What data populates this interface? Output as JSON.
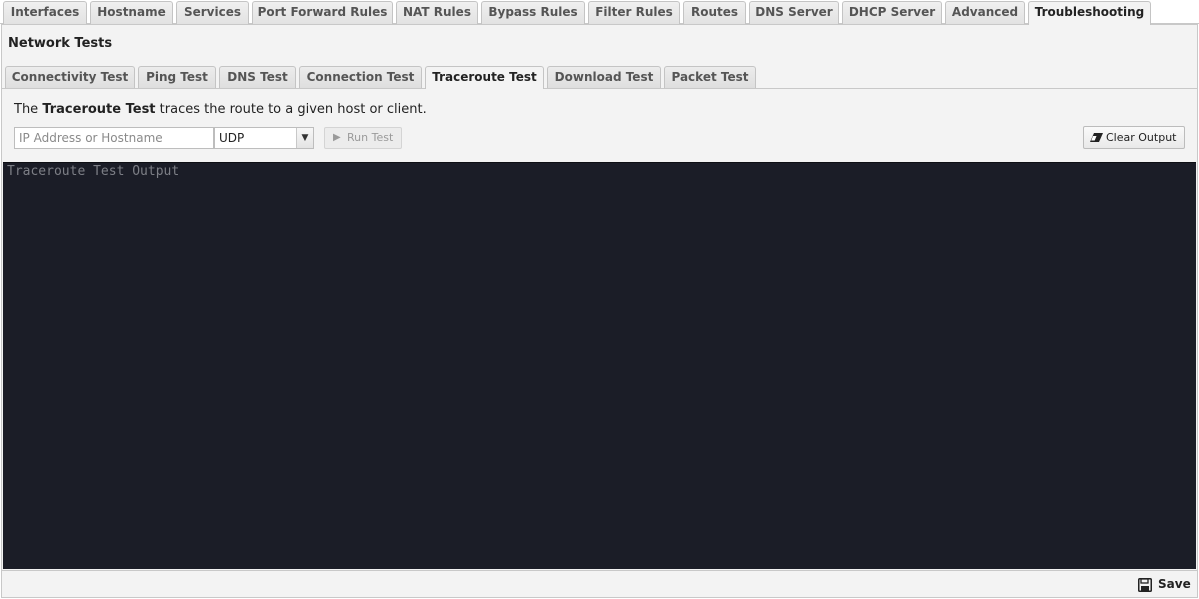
{
  "top_tabs": [
    {
      "label": "Interfaces"
    },
    {
      "label": "Hostname"
    },
    {
      "label": "Services"
    },
    {
      "label": "Port Forward Rules"
    },
    {
      "label": "NAT Rules"
    },
    {
      "label": "Bypass Rules"
    },
    {
      "label": "Filter Rules"
    },
    {
      "label": "Routes"
    },
    {
      "label": "DNS Server"
    },
    {
      "label": "DHCP Server"
    },
    {
      "label": "Advanced"
    },
    {
      "label": "Troubleshooting",
      "active": true
    }
  ],
  "panel": {
    "title": "Network Tests"
  },
  "sub_tabs": [
    {
      "label": "Connectivity Test"
    },
    {
      "label": "Ping Test"
    },
    {
      "label": "DNS Test"
    },
    {
      "label": "Connection Test"
    },
    {
      "label": "Traceroute Test",
      "active": true
    },
    {
      "label": "Download Test"
    },
    {
      "label": "Packet Test"
    }
  ],
  "description": {
    "prefix": "The ",
    "bold": "Traceroute Test",
    "suffix": " traces the route to a given host or client."
  },
  "form": {
    "host_placeholder": "IP Address or Hostname",
    "host_value": "",
    "protocol_selected": "UDP",
    "run_label": "Run Test",
    "run_disabled": true,
    "clear_label": "Clear Output"
  },
  "output": {
    "placeholder": "Traceroute Test Output"
  },
  "footer": {
    "save_label": "Save"
  },
  "icons": {
    "run": "play-icon",
    "clear": "eraser-icon",
    "save": "floppy-disk-icon"
  }
}
